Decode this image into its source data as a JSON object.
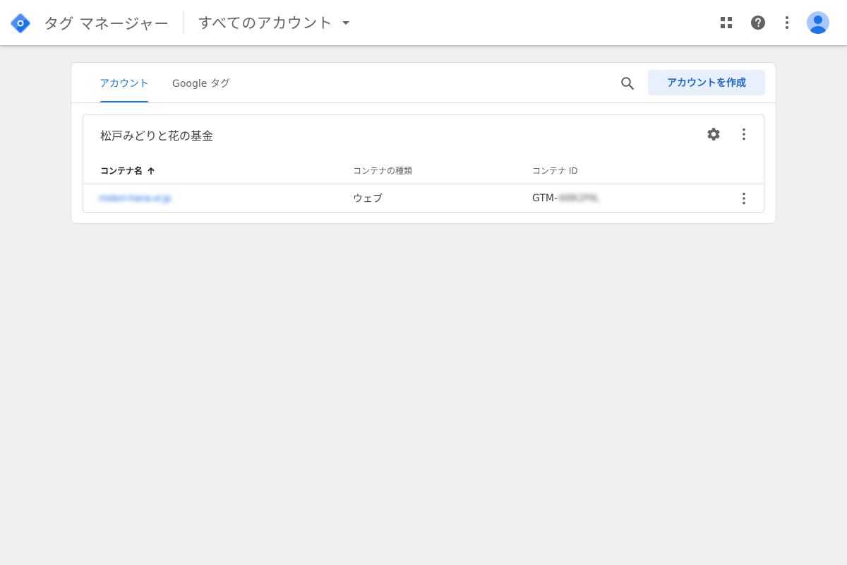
{
  "header": {
    "logo_icon": "tag-manager-logo-icon",
    "app_title": "タグ マネージャー",
    "account_picker_label": "すべてのアカウント",
    "icons": [
      "apps-grid-icon",
      "help-icon",
      "more-vert-icon",
      "account-avatar-icon"
    ]
  },
  "tabs": [
    {
      "label": "アカウント",
      "active": true
    },
    {
      "label": "Google タグ",
      "active": false
    }
  ],
  "toolbar": {
    "create_account_label": "アカウントを作成"
  },
  "account": {
    "name": "松戸みどりと花の基金",
    "columns": {
      "container_name": "コンテナ名",
      "container_type": "コンテナの種類",
      "container_id": "コンテナ ID"
    },
    "sort_icon": "arrow-up-icon",
    "rows": [
      {
        "container_name": "midori-hana.or.jp",
        "container_type": "ウェブ",
        "container_id_prefix": "GTM-",
        "container_id_rest": "W8K2P9L"
      }
    ]
  },
  "colors": {
    "accent": "#1a73e8",
    "page_background": "#eff1f1",
    "create_button_bg": "#e8f0fe"
  }
}
